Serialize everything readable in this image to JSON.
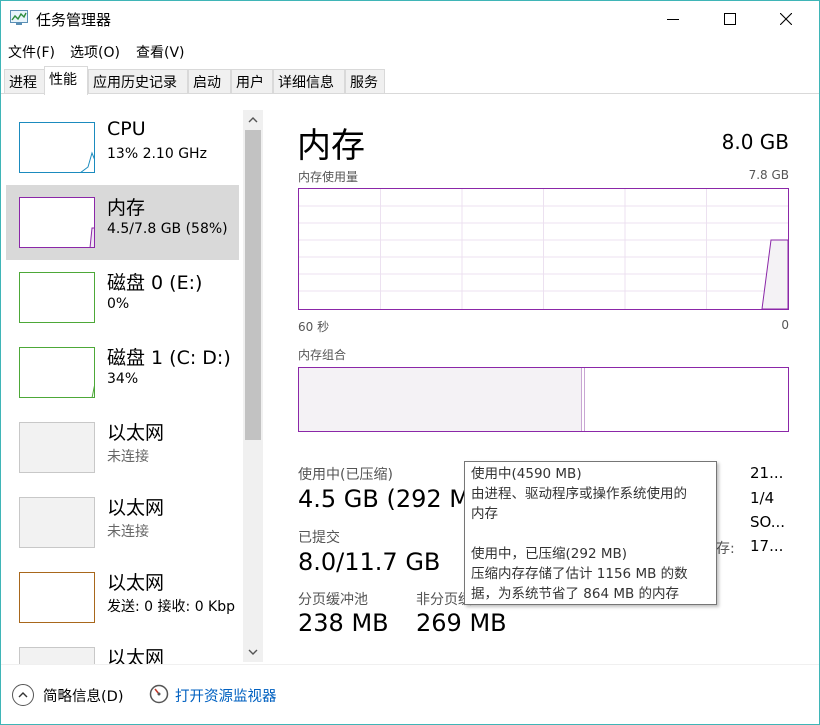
{
  "window": {
    "title": "任务管理器",
    "accent_color": "#3fb5b7"
  },
  "menu": [
    "文件(F)",
    "选项(O)",
    "查看(V)"
  ],
  "tabs": [
    {
      "label": "进程",
      "active": false
    },
    {
      "label": "性能",
      "active": true
    },
    {
      "label": "应用历史记录",
      "active": false
    },
    {
      "label": "启动",
      "active": false
    },
    {
      "label": "用户",
      "active": false
    },
    {
      "label": "详细信息",
      "active": false
    },
    {
      "label": "服务",
      "active": false
    }
  ],
  "sidebar": {
    "items": [
      {
        "title": "CPU",
        "subtitle": "13% 2.10 GHz",
        "color": "#1b8bbe",
        "selected": false,
        "gray": false
      },
      {
        "title": "内存",
        "subtitle": "4.5/7.8 GB (58%)",
        "color": "#8b27a8",
        "selected": true,
        "gray": false
      },
      {
        "title": "磁盘 0 (E:)",
        "subtitle": "0%",
        "color": "#4da838",
        "selected": false,
        "gray": false
      },
      {
        "title": "磁盘 1 (C: D:)",
        "subtitle": "34%",
        "color": "#4da838",
        "selected": false,
        "gray": false
      },
      {
        "title": "以太网",
        "subtitle": "未连接",
        "color": "#bbbbbb",
        "selected": false,
        "gray": true
      },
      {
        "title": "以太网",
        "subtitle": "未连接",
        "color": "#bbbbbb",
        "selected": false,
        "gray": true
      },
      {
        "title": "以太网",
        "subtitle": "发送: 0 接收: 0 Kbp",
        "color": "#a8671b",
        "selected": false,
        "gray": false
      },
      {
        "title": "以太网",
        "subtitle": "",
        "color": "#bbbbbb",
        "selected": false,
        "gray": true
      }
    ]
  },
  "main": {
    "title": "内存",
    "total": "8.0 GB",
    "usage_label": "内存使用量",
    "usage_max": "7.8 GB",
    "axis_left": "60 秒",
    "axis_right": "0",
    "compose_label": "内存组合",
    "in_use_label": "使用中(已压缩)",
    "in_use_value": "4.5 GB (292 M",
    "committed_label": "已提交",
    "committed_value": "8.0/11.7 GB",
    "paged_label": "分页缓冲池",
    "paged_value": "238 MB",
    "nonpaged_label": "非分页缓",
    "nonpaged_value": "269 MB",
    "right_col": [
      "21...",
      "1/4",
      "SO...",
      "17..."
    ],
    "right_col_label": "存:",
    "graph_color": "#8b27a8",
    "graph_fill": "#f4f2f5"
  },
  "tooltip": {
    "lines": [
      "使用中(4590 MB)",
      "由进程、驱动程序或操作系统使用的",
      "内存",
      "",
      "使用中，已压缩(292 MB)",
      "压缩内存存储了估计 1156 MB 的数",
      "据，为系统节省了 864 MB 的内存"
    ]
  },
  "bottom": {
    "fewer_details": "简略信息(D)",
    "resource_monitor": "打开资源监视器"
  }
}
